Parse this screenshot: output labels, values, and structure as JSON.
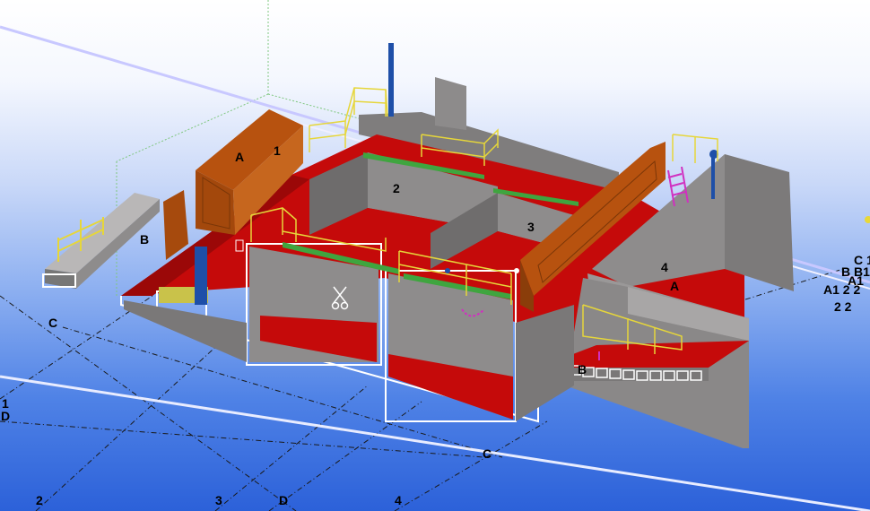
{
  "viewer": {
    "model_labels": [
      {
        "id": "grid-label-c-left",
        "text": "C"
      },
      {
        "id": "grid-label-b-left",
        "text": "B"
      },
      {
        "id": "grid-label-1-edge",
        "text": "1"
      },
      {
        "id": "grid-label-d-edge",
        "text": "D"
      },
      {
        "id": "grid-label-2-bottom",
        "text": "2"
      },
      {
        "id": "grid-label-3-bottom",
        "text": "3"
      },
      {
        "id": "grid-label-d-bottom",
        "text": "D"
      },
      {
        "id": "grid-label-4-bottom",
        "text": "4"
      },
      {
        "id": "grid-label-c-bottom",
        "text": "C"
      },
      {
        "id": "grid-label-b-mid",
        "text": "B"
      },
      {
        "id": "wall-label-a-left",
        "text": "A"
      },
      {
        "id": "wall-label-1",
        "text": "1"
      },
      {
        "id": "room-label-2",
        "text": "2"
      },
      {
        "id": "room-label-3",
        "text": "3"
      },
      {
        "id": "room-label-4",
        "text": "4"
      },
      {
        "id": "wall-label-a-right",
        "text": "A"
      },
      {
        "id": "grid-label-c1-right",
        "text": "C 1"
      },
      {
        "id": "grid-label-b1-right",
        "text": "B B1"
      },
      {
        "id": "grid-label-a1-right",
        "text": "A1"
      },
      {
        "id": "grid-label-a1-22-right",
        "text": "A1 2 2"
      },
      {
        "id": "grid-label-22-right",
        "text": "2 2"
      }
    ]
  },
  "colors": {
    "background_top": "#ffffff",
    "background_bottom": "#2c61d9",
    "floor": "#c50a0a",
    "concrete": "#8e8c8c",
    "timber_wall": "#b7520f",
    "railing": "#e6d63a",
    "pipe": "#1e4fa8",
    "beam": "#3fa53f",
    "cut_outline": "#ffffff",
    "grid_line": "#222222",
    "section_plane": "#c8c8ff"
  }
}
